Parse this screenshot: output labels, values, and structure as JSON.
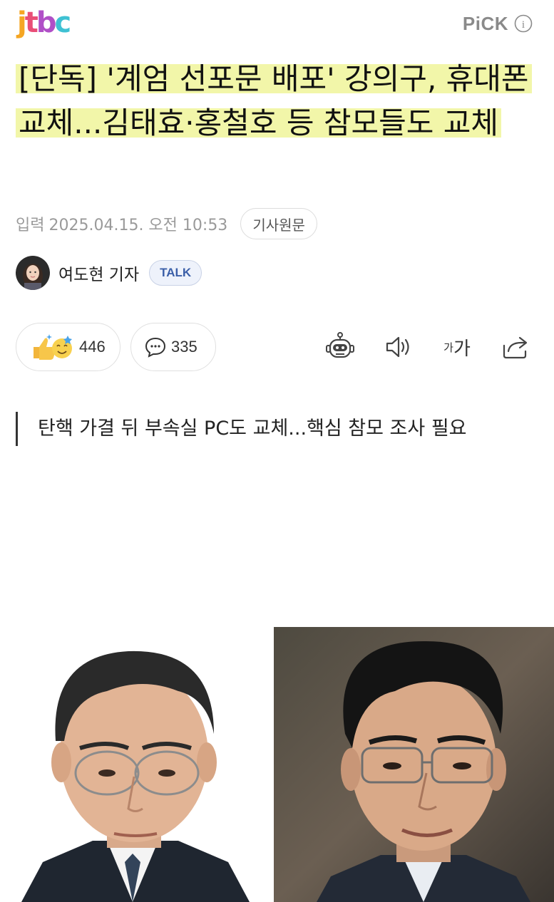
{
  "header": {
    "logo_letters": [
      "j",
      "t",
      "b",
      "c"
    ],
    "logo_text": "jtbc",
    "pick_label": "PiCK",
    "info_icon_label": "i"
  },
  "article": {
    "headline": "[단독] '계엄 선포문 배포' 강의구, 휴대폰 교체...김태효·홍철호 등 참모들도 교체",
    "date_prefix": "입력",
    "date": "2025.04.15. 오전 10:53",
    "original_button": "기사원문",
    "author_name": "여도현 기자",
    "talk_label": "TALK",
    "subheading": "탄핵 가결 뒤 부속실 PC도 교체...핵심 참모 조사 필요"
  },
  "reactions": {
    "like_count": "446",
    "comment_count": "335"
  },
  "tools": {
    "font_small": "가",
    "font_large": "가"
  },
  "colors": {
    "highlight": "#f2f6a9",
    "logo_j": "#f5a623",
    "logo_t": "#e94e77",
    "logo_b": "#b04fc7",
    "logo_c": "#3ec1d3",
    "talk_accent": "#3b5fa8"
  },
  "icons": [
    "info-icon",
    "thumbs-up-smile-icon",
    "comment-bubble-icon",
    "ai-robot-icon",
    "speaker-icon",
    "share-icon"
  ]
}
